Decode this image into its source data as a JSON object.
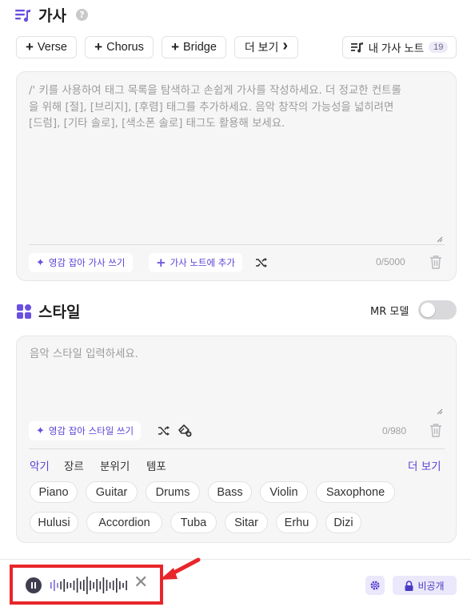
{
  "lyrics": {
    "title": "가사",
    "help": "?",
    "tag_buttons": [
      {
        "plus": "+",
        "label": "Verse"
      },
      {
        "plus": "+",
        "label": "Chorus"
      },
      {
        "plus": "+",
        "label": "Bridge"
      }
    ],
    "more_label": "더 보기",
    "more_chevron": "›",
    "note_button_label": "내 가사 노트",
    "note_count": "19",
    "placeholder_lines": [
      "/' 키를 사용하여 태그 목록을 탐색하고 손쉽게 가사를 작성하세요. 더 정교한 컨트롤",
      "을 위해 [절], [브리지], [후렴] 태그를 추가하세요. 음악 창작의 가능성을 넓히려면",
      "[드럼], [기타 솔로], [색소폰 솔로] 태그도 활용해 보세요."
    ],
    "inspire_label": "영감 잡아 가사 쓰기",
    "add_note_label": "가사 노트에 추가",
    "counter": "0/5000"
  },
  "style": {
    "title": "스타일",
    "mr_label": "MR 모델",
    "mr_enabled": false,
    "placeholder": "음악 스타일 입력하세요.",
    "inspire_label": "영감 잡아 스타일 쓰기",
    "counter": "0/980",
    "categories": [
      "악기",
      "장르",
      "분위기",
      "템포"
    ],
    "active_category": "악기",
    "more_label": "더 보기",
    "chips_row1": [
      "Piano",
      "Guitar",
      "Drums",
      "Bass",
      "Violin",
      "Saxophone"
    ],
    "chips_row2": [
      "Hulusi",
      "Accordion",
      "Tuba",
      "Sitar",
      "Erhu",
      "Dizi"
    ]
  },
  "bottom": {
    "close_glyph": "✕",
    "private_label": "비공개"
  },
  "colors": {
    "accent": "#5a3fd6",
    "highlight_border": "#e8262a",
    "arrow": "#e8262a"
  }
}
